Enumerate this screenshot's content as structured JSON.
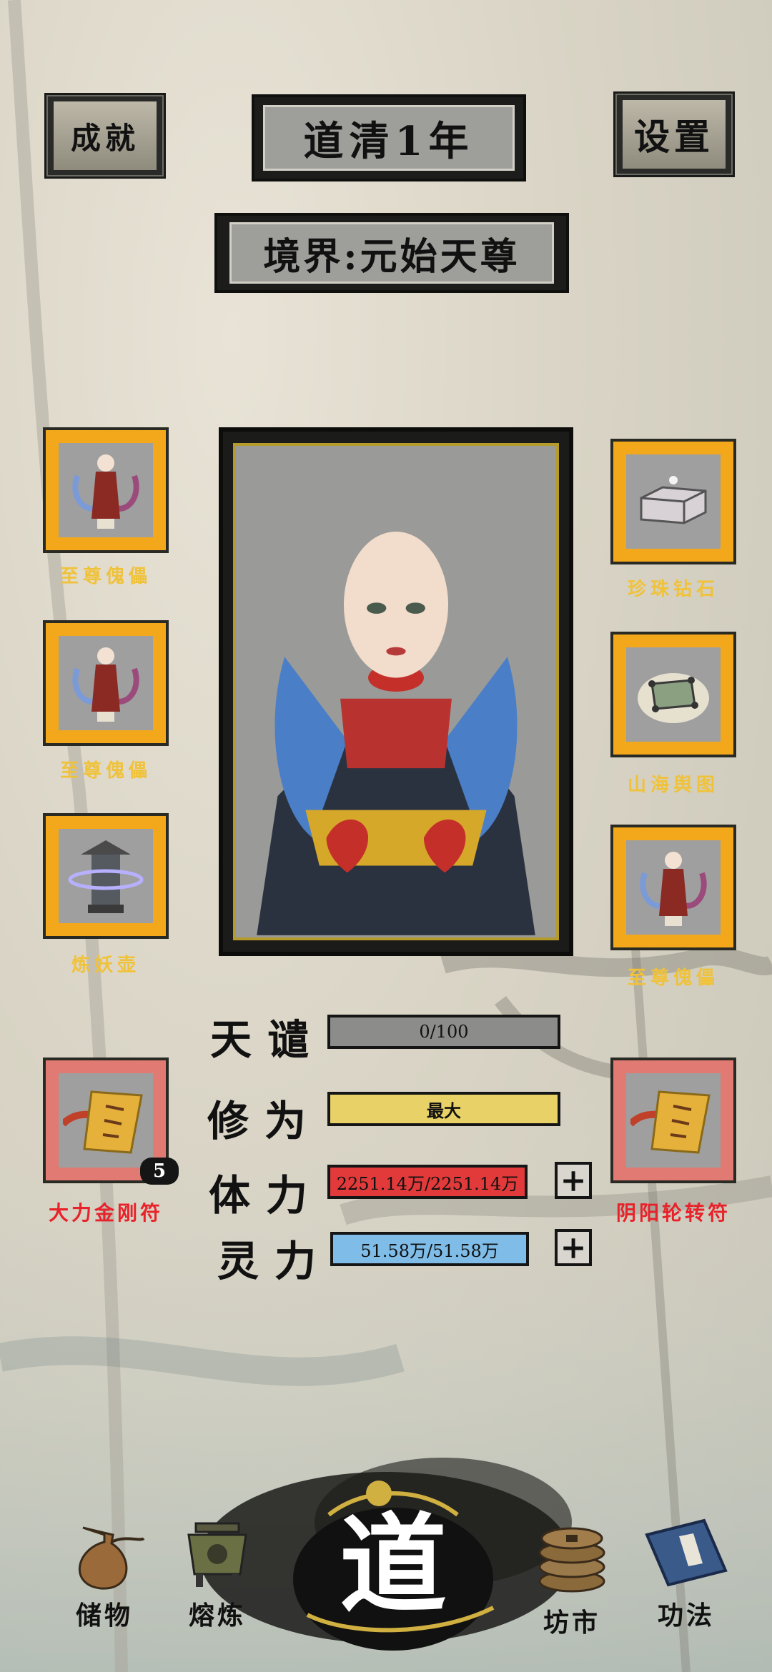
{
  "header": {
    "achievement_label": "成就",
    "title": "道清1年",
    "settings_label": "设置",
    "realm_text": "境界:元始天尊"
  },
  "left_slots": [
    {
      "label": "至尊傀儡",
      "icon": "puppet-figure-icon"
    },
    {
      "label": "至尊傀儡",
      "icon": "puppet-figure-icon"
    },
    {
      "label": "炼妖壶",
      "icon": "demon-refining-pot-icon"
    },
    {
      "label": "大力金刚符",
      "icon": "talisman-scroll-icon",
      "badge": "5"
    }
  ],
  "right_slots": [
    {
      "label": "珍珠钻石",
      "icon": "pearl-diamond-icon"
    },
    {
      "label": "山海舆图",
      "icon": "mountain-sea-map-icon"
    },
    {
      "label": "至尊傀儡",
      "icon": "puppet-figure-icon"
    },
    {
      "label": "阴阳轮转符",
      "icon": "talisman-scroll-icon"
    }
  ],
  "stats": {
    "tianqian": {
      "label": "天谴",
      "value": "0/100",
      "fill": 0.0
    },
    "xiuwei": {
      "label": "修为",
      "value": "最大",
      "fill": 1.0
    },
    "tili": {
      "label": "体力",
      "value": "2251.14万/2251.14万",
      "fill": 1.0
    },
    "lingli": {
      "label": "灵力",
      "value": "51.58万/51.58万",
      "fill": 1.0
    }
  },
  "nav": {
    "storage": "储物",
    "smelting": "熔炼",
    "dao": "道",
    "market": "坊市",
    "skills": "功法"
  },
  "colors": {
    "slot_gold": "#f2a81a",
    "slot_red": "#e07a72",
    "label_gold": "#f0c23a",
    "label_red": "#e8222a",
    "bar_gray": "#8c8c8a",
    "bar_yellow": "#e8d166",
    "bar_red": "#e23a3a",
    "bar_blue": "#7fbde8"
  }
}
